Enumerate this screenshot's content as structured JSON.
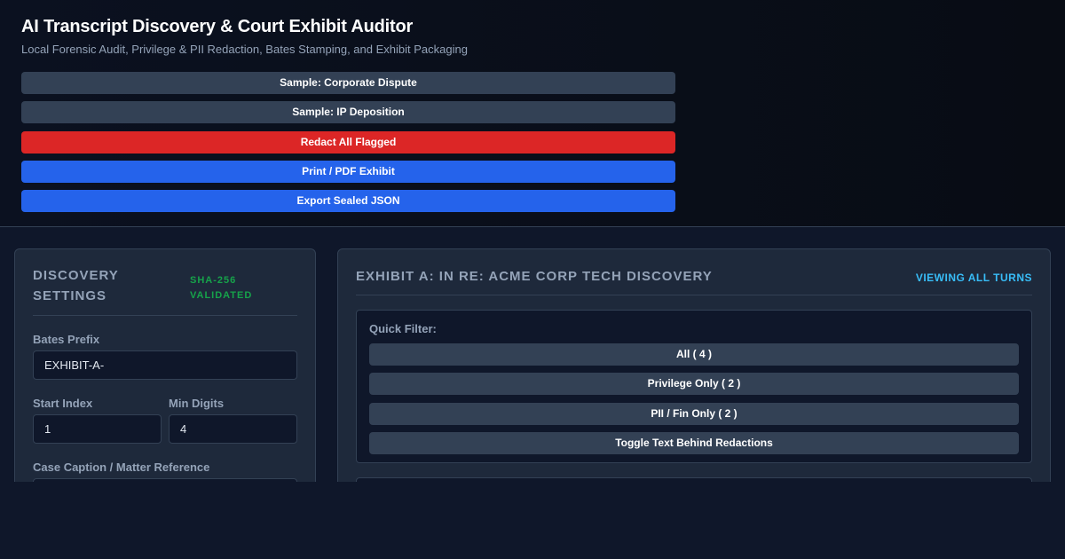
{
  "header": {
    "title": "AI Transcript Discovery & Court Exhibit Auditor",
    "subtitle": "Local Forensic Audit, Privilege & PII Redaction, Bates Stamping, and Exhibit Packaging",
    "actions": [
      {
        "label": "Sample: Corporate Dispute",
        "style": "gray"
      },
      {
        "label": "Sample: IP Deposition",
        "style": "gray"
      },
      {
        "label": "Redact All Flagged",
        "style": "red"
      },
      {
        "label": "Print / PDF Exhibit",
        "style": "blue"
      },
      {
        "label": "Export Sealed JSON",
        "style": "blue"
      }
    ]
  },
  "settings": {
    "title": "DISCOVERY SETTINGS",
    "badge": "SHA-256 VALIDATED",
    "bates_prefix": {
      "label": "Bates Prefix",
      "value": "EXHIBIT-A-"
    },
    "start_index": {
      "label": "Start Index",
      "value": "1"
    },
    "min_digits": {
      "label": "Min Digits",
      "value": "4"
    },
    "case_caption": {
      "label": "Case Caption / Matter Reference",
      "value": ""
    }
  },
  "exhibit": {
    "title": "EXHIBIT A: IN RE: ACME CORP TECH DISCOVERY",
    "status": "VIEWING ALL TURNS",
    "filter": {
      "label": "Quick Filter:",
      "buttons": [
        "All (  4  )",
        "Privilege Only (  2  )",
        "PII / Fin Only (  2  )",
        "Toggle Text Behind Redactions"
      ]
    }
  },
  "colors": {
    "background": "#0f172a",
    "panel": "#1e293b",
    "button_gray": "#334155",
    "button_red": "#dc2626",
    "button_blue": "#2563eb",
    "badge_green": "#16a34a",
    "status_cyan": "#38bdf8",
    "muted_text": "#94a3b8"
  }
}
